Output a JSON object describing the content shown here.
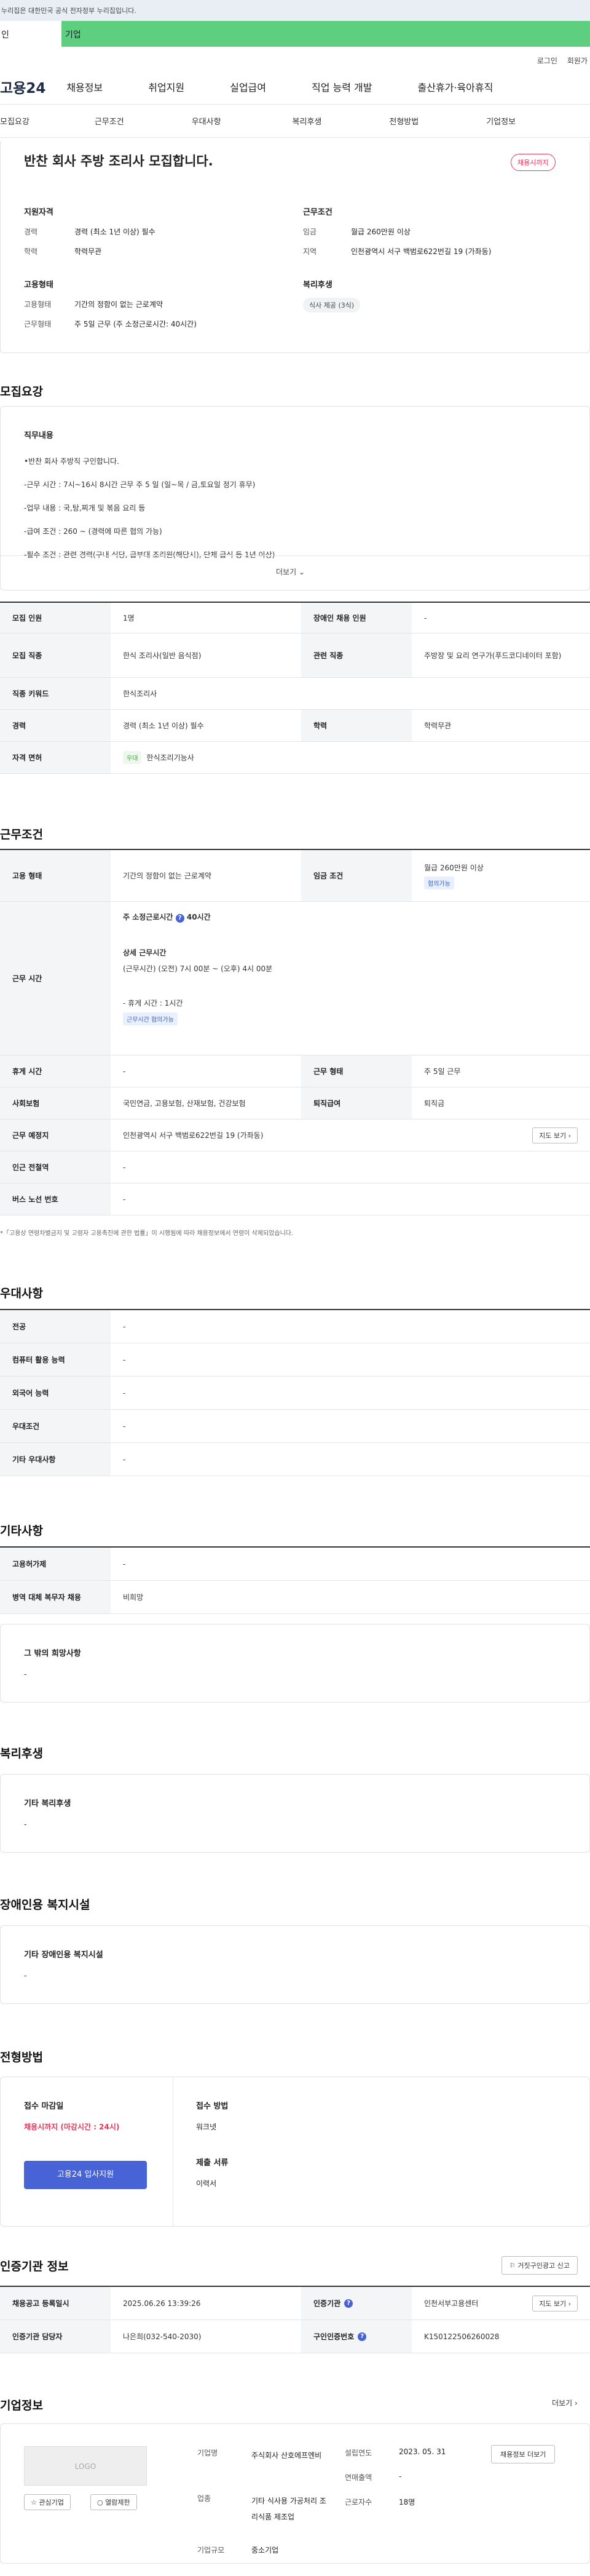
{
  "gov_banner": "누리집은 대한민국 공식 전자정부 누리집입니다.",
  "top_tabs": {
    "personal": "인",
    "company": "기업"
  },
  "util": {
    "login": "로그인",
    "join": "회원가"
  },
  "logo": "고용24",
  "gnb": [
    "채용정보",
    "취업지원",
    "실업급여",
    "직업 능력 개발",
    "출산휴가·육아휴직"
  ],
  "anchors": [
    "모집요강",
    "근무조건",
    "우대사항",
    "복리후생",
    "전형방법",
    "기업정보"
  ],
  "summary": {
    "title": "반찬 회사 주방 조리사 모집합니다.",
    "badge": "채용시까지",
    "req_title": "지원자격",
    "req_exp_l": "경력",
    "req_exp_v": "경력 (최소 1년 이상) 필수",
    "req_edu_l": "학력",
    "req_edu_v": "학력무관",
    "cond_title": "근무조건",
    "cond_wage_l": "임금",
    "cond_wage_v": "월급 260만원 이상",
    "cond_loc_l": "지역",
    "cond_loc_v": "인천광역시 서구 백범로622번길 19 (가좌동)",
    "emp_title": "고용형태",
    "emp_type_l": "고용형태",
    "emp_type_v": "기간의 정함이 없는 근로계약",
    "emp_work_l": "근무형태",
    "emp_work_v": "주 5일 근무 (주 소정근로시간: 40시간)",
    "wel_title": "복리후생",
    "wel_chip": "식사 제공 (3식)"
  },
  "recruit": {
    "title": "모집요강",
    "job_title": "직무내용",
    "job_lines": [
      "•반찬 회사 주방직 구인합니다.",
      "-근무 시간 : 7시~16시 8시간 근무 주 5 일 (일~목 / 금,토요일 정기 휴무)",
      "-업무 내용 : 국,탕,찌개 및 볶음 요리 등",
      "-급여 조건 : 260 ~ (경력에 따른 협의 가능)",
      "-필수 조건 : 관련 경력(구내 식당, 급부대 조리원(해당시), 단체 급식 등 1년 이상)"
    ],
    "more": "더보기",
    "rows": {
      "count_l": "모집 인원",
      "count_v": "1명",
      "dis_l": "장애인 채용 인원",
      "dis_v": "-",
      "job_l": "모집 직종",
      "job_v": "한식 조리사(일반 음식점)",
      "rel_l": "관련 직종",
      "rel_v": "주방장 및 요리 연구가(푸드코디네이터 포함)",
      "kw_l": "직종 키워드",
      "kw_v": "한식조리사",
      "exp_l": "경력",
      "exp_v": "경력 (최소 1년 이상) 필수",
      "edu_l": "학력",
      "edu_v": "학력무관",
      "lic_l": "자격 면허",
      "lic_tag": "우대",
      "lic_v": "한식조리기능사"
    }
  },
  "work": {
    "title": "근무조건",
    "emp_l": "고용 형태",
    "emp_v": "기간의 정함이 없는 근로계약",
    "wage_l": "임금 조건",
    "wage_v": "월급 260만원 이상",
    "wage_tag": "협의가능",
    "time_l": "근무 시간",
    "time_total": "주 소정근로시간",
    "time_total_v": "40시간",
    "time_detail_t": "상세 근무시간",
    "time_detail_v": "(근무시간) (오전) 7시 00분 ~ (오후) 4시 00분",
    "time_rest": "- 휴게 시간 : 1시간",
    "time_tag": "근무시간 협의가능",
    "rest_l": "휴게 시간",
    "rest_v": "-",
    "form_l": "근무 형태",
    "form_v": "주 5일 근무",
    "ins_l": "사회보험",
    "ins_v": "국민연금, 고용보험, 산재보험, 건강보험",
    "ret_l": "퇴직급여",
    "ret_v": "퇴직금",
    "place_l": "근무 예정지",
    "place_v": "인천광역시 서구 백범로622번길 19 (가좌동)",
    "map_btn": "지도 보기",
    "sub_l": "인근 전철역",
    "sub_v": "-",
    "bus_l": "버스 노선 번호",
    "bus_v": "-",
    "note": "*「고용상 연령차별금지 및 고령자 고용촉진에 관한 법률」이 시행됨에 따라 채용정보에서 연령이 삭제되었습니다."
  },
  "pref": {
    "title": "우대사항",
    "rows": [
      [
        "전공",
        "-"
      ],
      [
        "컴퓨터 활용 능력",
        "-"
      ],
      [
        "외국어 능력",
        "-"
      ],
      [
        "우대조건",
        "-"
      ],
      [
        "기타 우대사항",
        "-"
      ]
    ]
  },
  "etc": {
    "title": "기타사항",
    "rows": [
      [
        "고용허가제",
        "-"
      ],
      [
        "병역 대체 복무자 채용",
        "비희망"
      ]
    ],
    "other_t": "그 밖의 희망사항",
    "other_v": "-"
  },
  "welfare": {
    "title": "복리후생",
    "card_t": "기타 복리후생",
    "card_v": "-"
  },
  "disabled": {
    "title": "장애인용 복지시설",
    "card_t": "기타 장애인용 복지시설",
    "card_v": "-"
  },
  "process": {
    "title": "전형방법",
    "deadline_t": "접수 마감일",
    "deadline_v": "채용시까지 (마감시간 : 24시)",
    "apply_btn": "고용24 입사지원",
    "method_t": "접수 방법",
    "method_v": "워크넷",
    "docs_t": "제출 서류",
    "docs_v": "이력서"
  },
  "agency": {
    "title": "인증기관 정보",
    "report_btn": "거짓구인광고 신고",
    "reg_l": "채용공고 등록일시",
    "reg_v": "2025.06.26 13:39:26",
    "org_l": "인증기관",
    "org_v": "인천서부고용센터",
    "map_btn": "지도 보기",
    "mgr_l": "인증기관 담당자",
    "mgr_v": "나은희(032-540-2030)",
    "no_l": "구인인증번호",
    "no_v": "K150122506260028"
  },
  "company": {
    "title": "기업정보",
    "more": "더보기",
    "logo_t": "LOGO",
    "fav_btn": "관심기업",
    "hide_btn": "열람제한",
    "name_l": "기업명",
    "name_v": "주식회사 산호에프엔비",
    "est_l": "설립연도",
    "est_v": "2023. 05. 31",
    "sales_l": "연매출액",
    "sales_v": "-",
    "ind_l": "업종",
    "ind_v": "기타 식사용 가공처리 조리식품 제조업",
    "emp_l": "근로자수",
    "emp_v": "18명",
    "size_l": "기업규모",
    "size_v": "중소기업",
    "recruit_btn": "채용정보 더보기"
  },
  "colors": {
    "brand": "#1f2a44",
    "green_tab": "#5ecf7e",
    "accent": "#e8375b",
    "btn": "#4763d6"
  }
}
